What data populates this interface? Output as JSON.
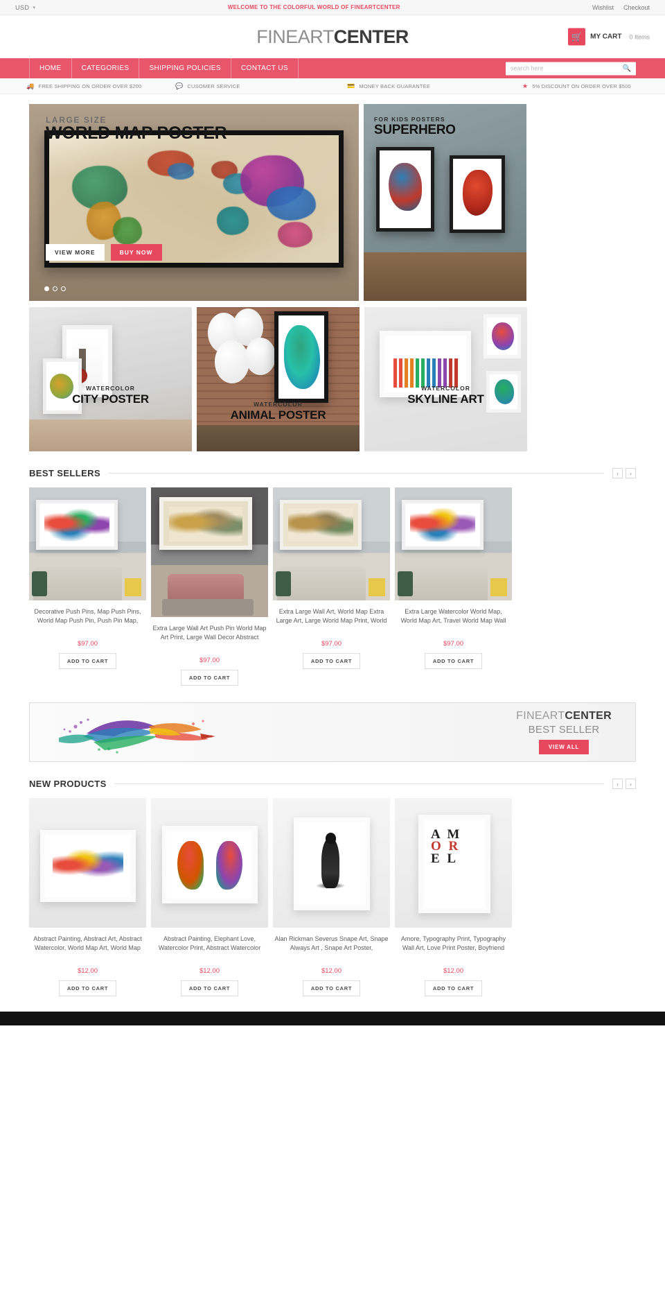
{
  "topbar": {
    "currency": "USD",
    "caret_icon": "chevron-down-icon",
    "welcome": "WELCOME TO THE COLORFUL WORLD OF FINEARTCENTER",
    "links": [
      "Wishlist",
      "Checkout"
    ]
  },
  "header": {
    "logo_light": "FINEART",
    "logo_bold": "CENTER",
    "cart_icon": "shopping-cart-icon",
    "cart_label": "MY CART",
    "cart_count": "0 Items"
  },
  "nav": {
    "items": [
      "HOME",
      "CATEGORIES",
      "SHIPPING POLICIES",
      "CONTACT US"
    ],
    "search_placeholder": "search here",
    "search_value": "",
    "search_icon": "search-icon"
  },
  "features": [
    {
      "icon": "truck-icon",
      "label": "FREE SHIPPING ON ORDER OVER $200"
    },
    {
      "icon": "chat-bubble-icon",
      "label": "CUSOMER SERVICE"
    },
    {
      "icon": "money-icon",
      "label": "MONEY BACK GUARANTEE"
    },
    {
      "icon": "star-icon",
      "label": "5% DISCOUNT ON ORDER OVER $500"
    }
  ],
  "hero": {
    "subtitle": "LARGE SIZE",
    "title": "WORLD MAP POSTER",
    "view_more": "VIEW MORE",
    "buy_now": "BUY NOW",
    "slides": 3,
    "active_slide": 1
  },
  "hero_side": {
    "subtitle": "FOR KIDS POSTERS",
    "title": "SUPERHERO"
  },
  "categories": [
    {
      "sub": "WATERCOLOR",
      "title": "CITY POSTER"
    },
    {
      "sub": "WATERCOLOR",
      "title": "ANIMAL POSTER"
    },
    {
      "sub": "WATERCOLOR",
      "title": "SKYLINE ART"
    }
  ],
  "best_sellers": {
    "title": "BEST SELLERS",
    "prev_icon": "chevron-left-icon",
    "next_icon": "chevron-right-icon",
    "add_to_cart": "ADD TO CART",
    "products": [
      {
        "title": "Decorative Push Pins, Map Push Pins, World Map Push Pin, Push Pin Map,",
        "price": "$97.00"
      },
      {
        "title": "Extra Large Wall Art Push Pin World Map Art Print, Large Wall Decor Abstract",
        "price": "$97.00"
      },
      {
        "title": "Extra Large Wall Art, World Map Extra Large Art, Large World Map Print, World",
        "price": "$97.00"
      },
      {
        "title": "Extra Large Watercolor World Map, World Map Art, Travel World Map Wall",
        "price": "$97.00"
      }
    ]
  },
  "promo": {
    "logo_light": "FINEART",
    "logo_bold": "CENTER",
    "subtitle": "BEST SELLER",
    "button": "VIEW ALL"
  },
  "new_products": {
    "title": "NEW PRODUCTS",
    "prev_icon": "chevron-left-icon",
    "next_icon": "chevron-right-icon",
    "add_to_cart": "ADD TO CART",
    "products": [
      {
        "title": "Abstract Painting, Abstract Art, Abstract Watercolor, World Map Art, World Map",
        "price": "$12.00"
      },
      {
        "title": "Abstract Painting, Elephant Love, Watercolor Print, Abstract Watercolor",
        "price": "$12.00"
      },
      {
        "title": "Alan Rickman Severus Snape Art, Snape Always Art , Snape Art Poster,",
        "price": "$12.00"
      },
      {
        "title": "Amore, Typography Print, Typography Wall Art, Love Print Poster, Boyfriend",
        "price": "$12.00"
      }
    ]
  },
  "colors": {
    "accent": "#e8485e",
    "nav": "#e8566b",
    "text": "#5b5b5b"
  }
}
